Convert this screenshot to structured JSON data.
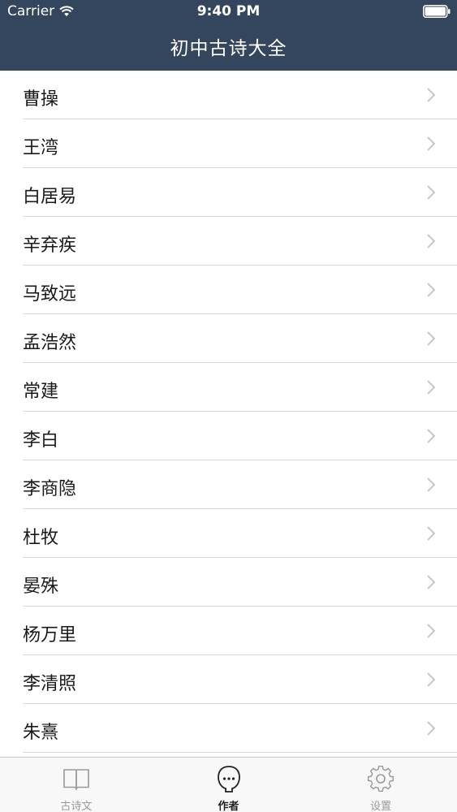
{
  "status_bar": {
    "carrier": "Carrier",
    "time": "9:40 PM",
    "wifi_icon": "wifi-icon",
    "battery_icon": "battery-icon"
  },
  "nav": {
    "title": "初中古诗大全"
  },
  "authors": [
    {
      "name": "曹操"
    },
    {
      "name": "王湾"
    },
    {
      "name": "白居易"
    },
    {
      "name": "辛弃疾"
    },
    {
      "name": "马致远"
    },
    {
      "name": "孟浩然"
    },
    {
      "name": "常建"
    },
    {
      "name": "李白"
    },
    {
      "name": "李商隐"
    },
    {
      "name": "杜牧"
    },
    {
      "name": "晏殊"
    },
    {
      "name": "杨万里"
    },
    {
      "name": "李清照"
    },
    {
      "name": "朱熹"
    }
  ],
  "tabs": [
    {
      "label": "古诗文",
      "icon": "book-icon",
      "active": false
    },
    {
      "label": "作者",
      "icon": "person-chat-icon",
      "active": true
    },
    {
      "label": "设置",
      "icon": "gear-icon",
      "active": false
    }
  ],
  "colors": {
    "header": "#34465d",
    "tab_active": "#222222",
    "tab_inactive": "#9a9a9a",
    "chevron": "#c7c7cc",
    "separator": "#d9d9d9"
  }
}
